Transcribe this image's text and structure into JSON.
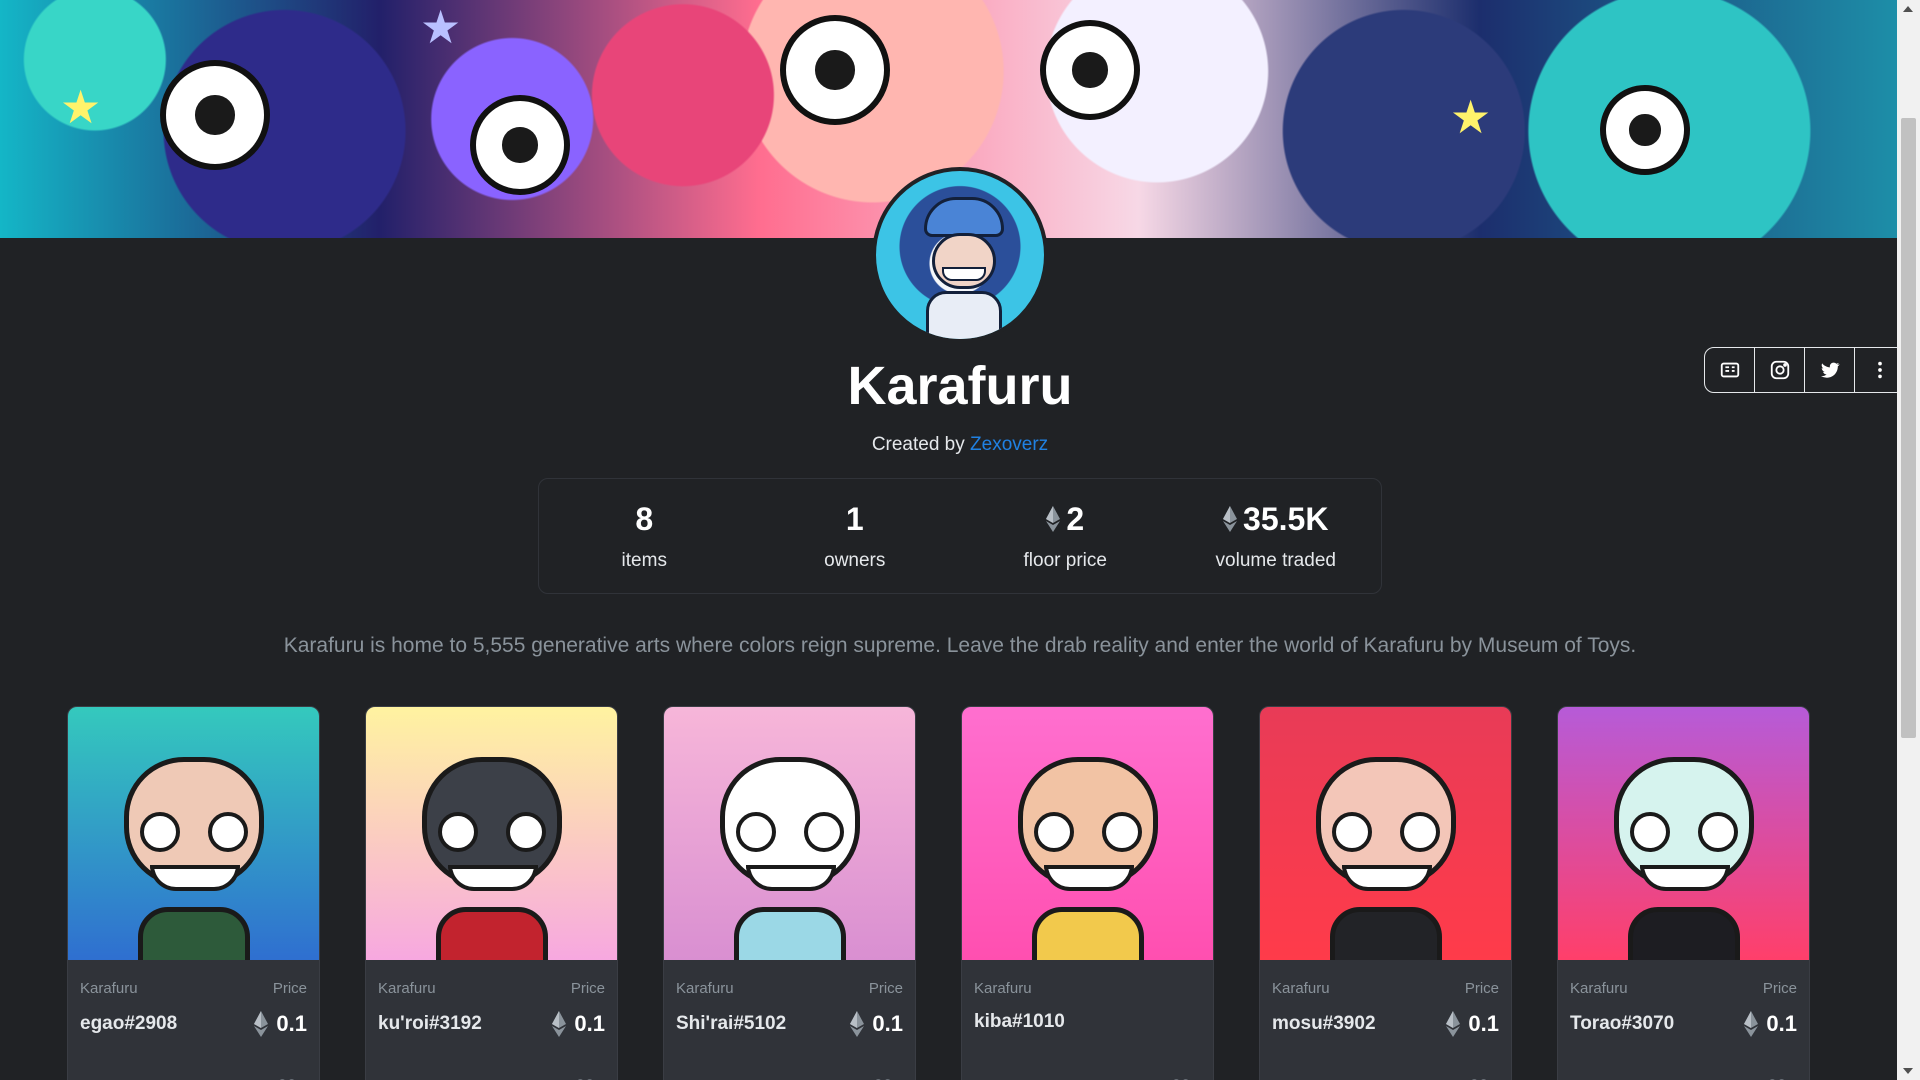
{
  "collection": {
    "title": "Karafuru",
    "created_by_prefix": "Created by",
    "creator": "Zexoverz",
    "description": "Karafuru is home to 5,555 generative arts where colors reign supreme. Leave the drab reality and enter the world of Karafuru by Museum of Toys."
  },
  "stats": [
    {
      "value": "8",
      "label": "items",
      "eth": false
    },
    {
      "value": "1",
      "label": "owners",
      "eth": false
    },
    {
      "value": "2",
      "label": "floor price",
      "eth": true
    },
    {
      "value": "35.5K",
      "label": "volume traded",
      "eth": true
    }
  ],
  "social": [
    "website-icon",
    "instagram-icon",
    "twitter-icon",
    "more-icon"
  ],
  "cards": [
    {
      "collection": "Karafuru",
      "price_label": "Price",
      "name": "egao#2908",
      "price": "0.1",
      "bg": [
        "#34c9bd",
        "#2f6fd0"
      ],
      "head": "#efc9b6",
      "torso": "#2d5a3a"
    },
    {
      "collection": "Karafuru",
      "price_label": "Price",
      "name": "ku'roi#3192",
      "price": "0.1",
      "bg": [
        "#fff3a0",
        "#f7a8e0"
      ],
      "head": "#3c4048",
      "torso": "#c2232e"
    },
    {
      "collection": "Karafuru",
      "price_label": "Price",
      "name": "Shi'rai#5102",
      "price": "0.1",
      "bg": [
        "#f7b6d9",
        "#d98fd1"
      ],
      "head": "#ffffff",
      "torso": "#9bd8e6"
    },
    {
      "collection": "Karafuru",
      "price_label": "",
      "name": "kiba#1010",
      "price": "",
      "bg": [
        "#ff6fcf",
        "#ff4fb0"
      ],
      "head": "#f2c3a4",
      "torso": "#f2c94c"
    },
    {
      "collection": "Karafuru",
      "price_label": "Price",
      "name": "mosu#3902",
      "price": "0.1",
      "bg": [
        "#e83b57",
        "#ff3b4a"
      ],
      "head": "#f3c6b8",
      "torso": "#222327"
    },
    {
      "collection": "Karafuru",
      "price_label": "Price",
      "name": "Torao#3070",
      "price": "0.1",
      "bg": [
        "#b65bd8",
        "#ff3f6a"
      ],
      "head": "#d6f3ee",
      "torso": "#1d1d22"
    }
  ]
}
